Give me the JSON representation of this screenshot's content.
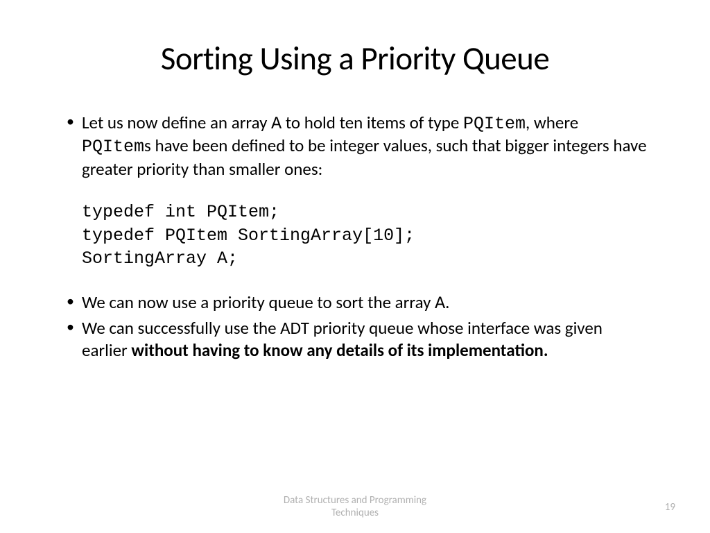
{
  "slide": {
    "title": "Sorting Using a Priority Queue",
    "bullets": {
      "b1_pre": "Let us now define an array ",
      "b1_code1": "A",
      "b1_mid1": " to hold ten items of type ",
      "b1_code2": "PQItem",
      "b1_mid2": ", where ",
      "b1_code3": "PQItem",
      "b1_post": "s have been defined to be integer values, such that bigger integers have greater priority than smaller ones:",
      "code1": "typedef int PQItem;",
      "code2": "typedef PQItem SortingArray[10];",
      "code3": "SortingArray A;",
      "b2_pre": "We can now use a priority queue to sort the array ",
      "b2_code1": "A",
      "b2_post": ".",
      "b3_pre": "We can successfully use the ADT priority queue whose interface was given earlier ",
      "b3_bold": "without having to know any details of its implementation."
    },
    "footer": "Data Structures and Programming Techniques",
    "page": "19"
  }
}
